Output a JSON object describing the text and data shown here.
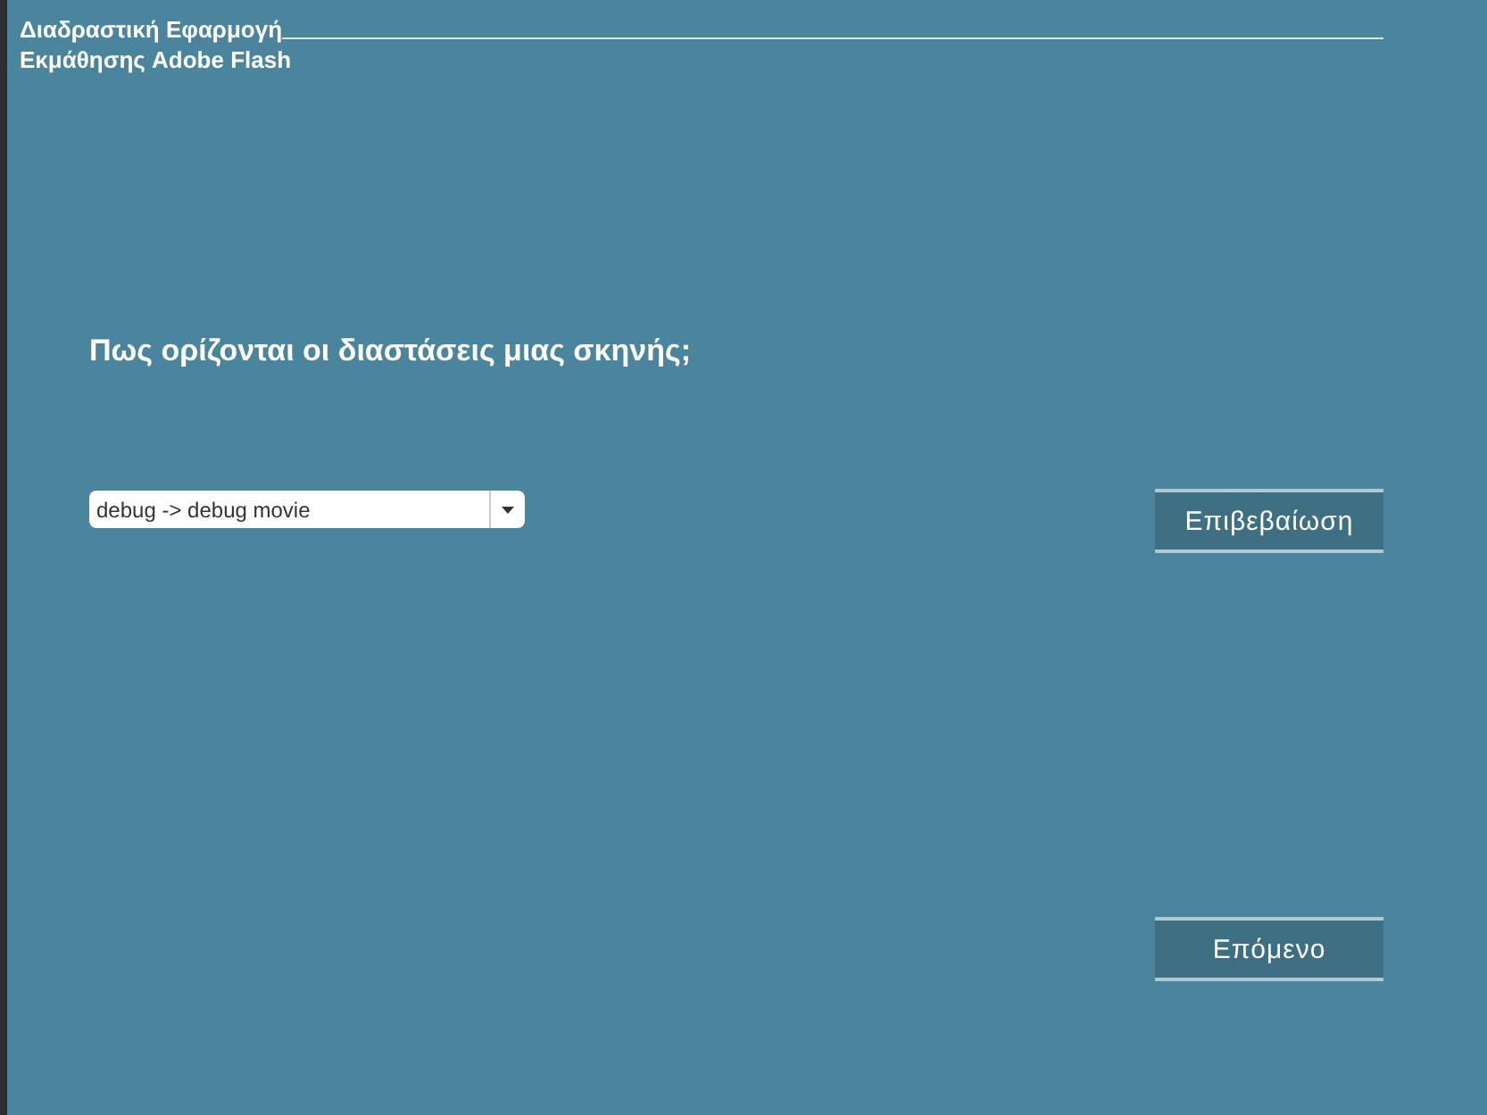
{
  "header": {
    "title_line_1": "Διαδραστική Εφαρμογή",
    "title_line_2": "Εκμάθησης Adobe Flash"
  },
  "question": "Πως ορίζονται οι διαστάσεις μιας σκηνής;",
  "answer_select": {
    "value": "debug -> debug movie"
  },
  "confirm_button": "Επιβεβαίωση",
  "next_button": "Επόμενο"
}
